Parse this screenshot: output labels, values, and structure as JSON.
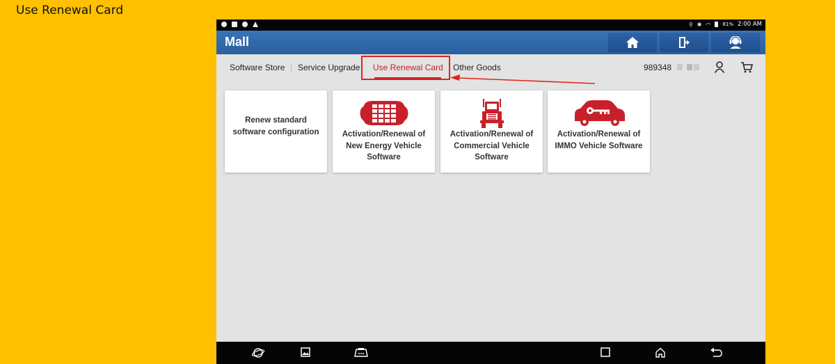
{
  "slide": {
    "title": "Use Renewal Card"
  },
  "status_bar": {
    "battery": "81%",
    "time": "2:00 AM",
    "icons": [
      "shield-icon",
      "image-icon",
      "cast-icon",
      "warning-icon",
      "location-icon",
      "bluetooth-icon",
      "wifi-icon",
      "battery-icon"
    ]
  },
  "app_bar": {
    "title": "Mall",
    "buttons": [
      "home-icon",
      "exit-icon",
      "support-agent-icon"
    ]
  },
  "tabs": [
    {
      "label": "Software Store",
      "active": false
    },
    {
      "label": "Service Upgrade",
      "active": false
    },
    {
      "label": "Use Renewal Card",
      "active": true
    },
    {
      "label": "Other Goods",
      "active": false
    }
  ],
  "account": {
    "id": "989348"
  },
  "header_icons": [
    "user-icon",
    "cart-icon"
  ],
  "cards": [
    {
      "label": "Renew standard software configuration",
      "icon": ""
    },
    {
      "label": "Activation/Renewal of New Energy Vehicle Software",
      "icon": "battery-car-icon"
    },
    {
      "label": "Activation/Renewal of Commercial Vehicle Software",
      "icon": "truck-icon"
    },
    {
      "label": "Activation/Renewal of IMMO Vehicle Software",
      "icon": "car-key-icon"
    }
  ],
  "nav_bar": {
    "icons": [
      "browser-icon",
      "gallery-icon",
      "vci-icon",
      "recent-apps-icon",
      "home-nav-icon",
      "back-icon"
    ]
  },
  "colors": {
    "slide_background": "#FFC000",
    "app_bar": "#2F69AC",
    "accent": "#C8202A",
    "annotation": "#E2231A",
    "content_background": "#E3E3E3"
  }
}
